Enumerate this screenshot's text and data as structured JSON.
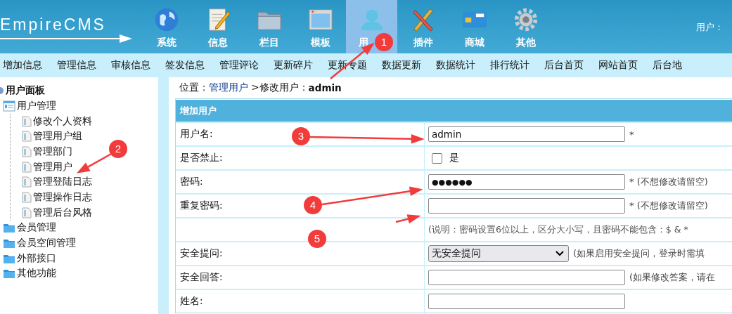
{
  "header": {
    "logo": "EmpireCMS",
    "nav": [
      {
        "label": "系统",
        "selected": false
      },
      {
        "label": "信息",
        "selected": false
      },
      {
        "label": "栏目",
        "selected": false
      },
      {
        "label": "模板",
        "selected": false
      },
      {
        "label": "用",
        "selected": true
      },
      {
        "label": "插件",
        "selected": false
      },
      {
        "label": "商城",
        "selected": false
      },
      {
        "label": "其他",
        "selected": false
      }
    ],
    "user_label": "用户："
  },
  "submenu": [
    "增加信息",
    "管理信息",
    "审核信息",
    "签发信息",
    "管理评论",
    "更新碎片",
    "更新专题",
    "数据更新",
    "数据统计",
    "排行统计",
    "后台首页",
    "网站首页",
    "后台地"
  ],
  "sidebar": {
    "title": "用户面板",
    "tree": [
      {
        "label": "用户管理",
        "expanded": true,
        "children": [
          {
            "label": "修改个人资料"
          },
          {
            "label": "管理用户组"
          },
          {
            "label": "管理部门"
          },
          {
            "label": "管理用户"
          },
          {
            "label": "管理登陆日志"
          },
          {
            "label": "管理操作日志"
          },
          {
            "label": "管理后台风格"
          }
        ]
      },
      {
        "label": "会员管理",
        "expanded": false
      },
      {
        "label": "会员空间管理",
        "expanded": false
      },
      {
        "label": "外部接口",
        "expanded": false
      },
      {
        "label": "其他功能",
        "expanded": false
      }
    ]
  },
  "breadcrumb": {
    "prefix": "位置：",
    "link": "管理用户",
    "middle": " >修改用户：",
    "current": "admin"
  },
  "form": {
    "title": "增加用户",
    "rows": [
      {
        "kind": "text",
        "label": "用户名:",
        "value": "admin",
        "suffix": "*"
      },
      {
        "kind": "checkbox",
        "label": "是否禁止:",
        "option": "是",
        "checked": false
      },
      {
        "kind": "password",
        "label": "密码:",
        "value": "●●●●●●",
        "suffix": "* (不想修改请留空)"
      },
      {
        "kind": "password",
        "label": "重复密码:",
        "value": "",
        "suffix": "* (不想修改请留空)"
      },
      {
        "kind": "note",
        "label": "",
        "note": "(说明：密码设置6位以上，区分大小写，且密码不能包含：$ & *"
      },
      {
        "kind": "select",
        "label": "安全提问:",
        "value": "无安全提问",
        "suffix": "(如果启用安全提问，登录时需填"
      },
      {
        "kind": "text",
        "label": "安全回答:",
        "value": "",
        "suffix": "(如果修改答案，请在"
      },
      {
        "kind": "text",
        "label": "姓名:",
        "value": "",
        "suffix": ""
      }
    ]
  },
  "annotations": [
    {
      "label": "1"
    },
    {
      "label": "2"
    },
    {
      "label": "3"
    },
    {
      "label": "4"
    },
    {
      "label": "5"
    }
  ]
}
